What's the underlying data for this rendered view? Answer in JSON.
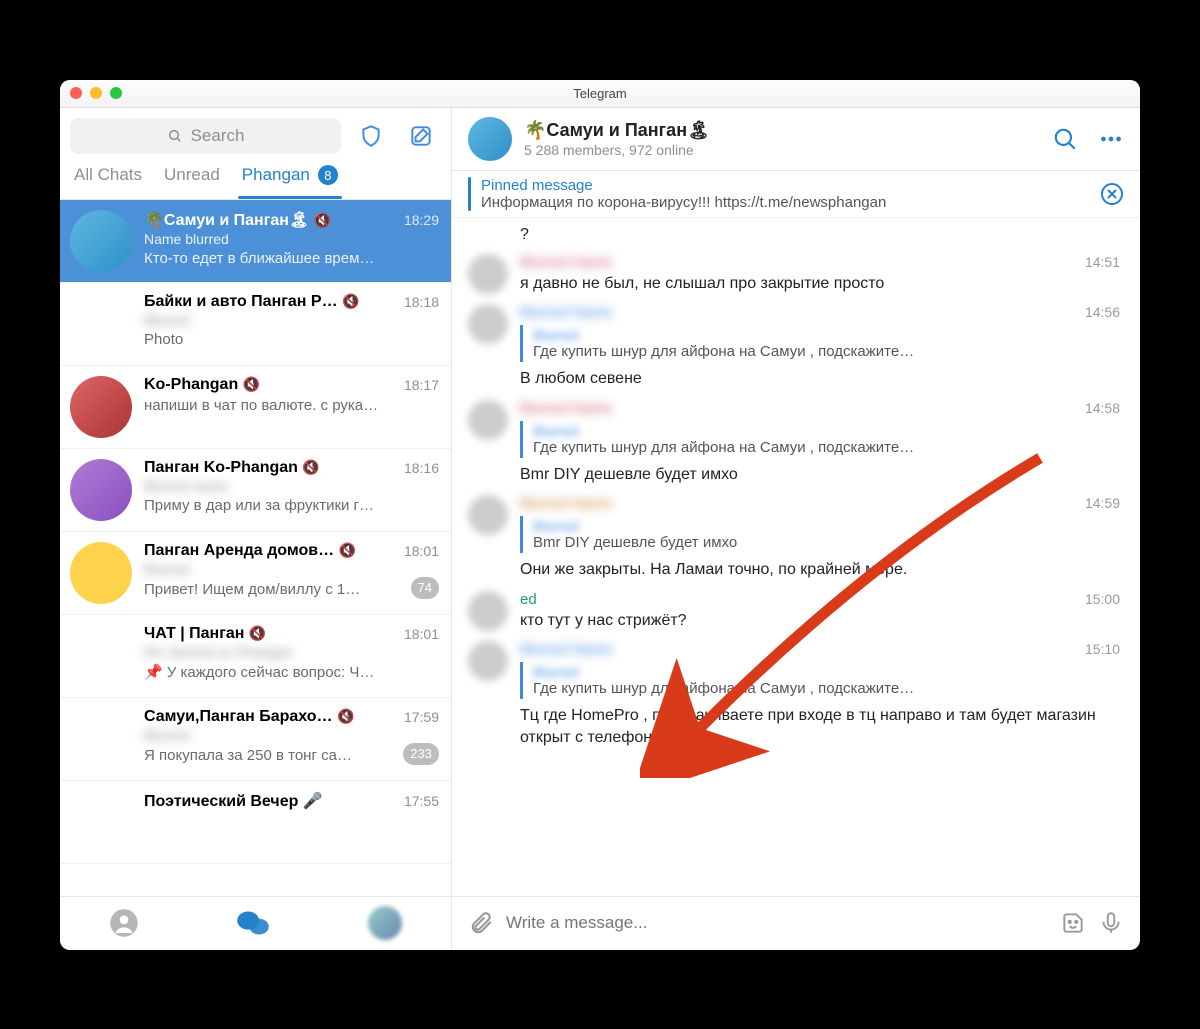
{
  "window": {
    "title": "Telegram"
  },
  "sidebar": {
    "search_placeholder": "Search",
    "tabs": [
      {
        "label": "All Chats"
      },
      {
        "label": "Unread"
      },
      {
        "label": "Phangan",
        "badge": "8"
      }
    ],
    "chats": [
      {
        "name": "🌴Самуи и Панган🏝",
        "sub": "Name blurred",
        "preview": "Кто-то едет в ближайшее врем…",
        "time": "18:29",
        "muted": true,
        "selected": true,
        "badge": ""
      },
      {
        "name": "Байки и авто Панган Р…",
        "sub": "Blurred",
        "preview": "Photo",
        "time": "18:18",
        "muted": true
      },
      {
        "name": "Ko-Phangan",
        "sub": "",
        "preview": "напиши в чат по валюте. с рука…",
        "time": "18:17",
        "muted": true
      },
      {
        "name": "Панган Ko-Phangan",
        "sub": "Blurred name",
        "preview": "Приму в дар или за фруктики г…",
        "time": "18:16",
        "muted": true
      },
      {
        "name": "Панган Аренда домов…",
        "sub": "Blurred",
        "preview": "Привет! Ищем дом/виллу с 1…",
        "time": "18:01",
        "muted": true,
        "badge": "74"
      },
      {
        "name": "ЧАТ | Панган",
        "sub": "Re: blurred on Phangan",
        "preview": "📌 У каждого сейчас вопрос: Ч…",
        "time": "18:01",
        "muted": true
      },
      {
        "name": "Самуи,Панган Барахо…",
        "sub": "Blurred",
        "preview": "Я покупала за 250 в тонг са…",
        "time": "17:59",
        "muted": true,
        "badge": "233"
      },
      {
        "name": "Поэтический Вечер 🎤",
        "sub": "",
        "preview": "",
        "time": "17:55",
        "muted": false
      }
    ]
  },
  "chat": {
    "title": "🌴Самуи и Панган🏝",
    "subtitle": "5 288 members, 972 online",
    "pinned": {
      "title": "Pinned message",
      "text": "Информация по корона-вирусу!!! https://t.me/newsphangan"
    },
    "messages": [
      {
        "kind": "tail",
        "text": "?"
      },
      {
        "kind": "msg",
        "name": "Blurred Name",
        "time": "14:51",
        "text": "я давно не был, не слышал про закрытие просто",
        "name_color": "#c85a7a"
      },
      {
        "kind": "msg",
        "name": "Blurred Name",
        "time": "14:56",
        "reply": {
          "name": "Blurred",
          "text": "Где купить шнур для айфона  на Самуи , подскажите…"
        },
        "text": "В любом севене",
        "name_color": "#3f8ae0"
      },
      {
        "kind": "msg",
        "name": "Blurred Name",
        "time": "14:58",
        "reply": {
          "name": "Blurred",
          "text": "Где купить шнур для айфона  на Самуи , подскажите…"
        },
        "text": "Bmr DIY дешевле будет имхо",
        "name_color": "#d05858"
      },
      {
        "kind": "msg",
        "name": "Blurred Name",
        "time": "14:59",
        "reply": {
          "name": "Blurred",
          "text": "Bmr DIY дешевле будет имхо"
        },
        "text": "Они же закрыты. На Ламаи точно, по крайней мере.",
        "name_color": "#cf7a2f"
      },
      {
        "kind": "msg",
        "name": "ed",
        "time": "15:00",
        "text": "кто тут у нас стрижёт?",
        "name_color": "#1aa36a",
        "clear": true
      },
      {
        "kind": "msg",
        "name": "Blurred Name",
        "time": "15:10",
        "reply": {
          "name": "Blurred",
          "text": "Где купить шнур для айфона  на Самуи , подскажите…"
        },
        "text": "Тц где HomePro , поворачиваете при входе в тц направо и там будет магазин открыт с телефонами",
        "name_color": "#3f8ae0"
      }
    ],
    "composer_placeholder": "Write a message..."
  },
  "colors": {
    "accent": "#2481cc",
    "arrow": "#d83a1a"
  }
}
